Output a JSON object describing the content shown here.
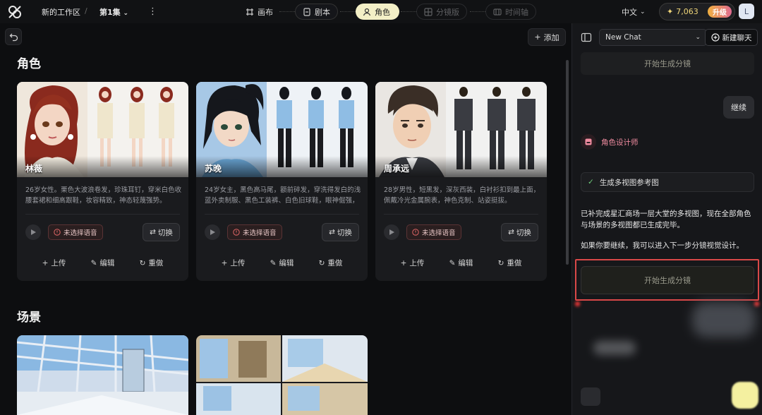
{
  "topbar": {
    "workspace": "新的工作区",
    "separator": "/",
    "episode": "第1集",
    "steps": [
      {
        "label": "画布",
        "icon": "canvas-icon",
        "state": "normal"
      },
      {
        "label": "剧本",
        "icon": "script-icon",
        "state": "normal"
      },
      {
        "label": "角色",
        "icon": "character-icon",
        "state": "active"
      },
      {
        "label": "分镜版",
        "icon": "storyboard-icon",
        "state": "disabled"
      },
      {
        "label": "时间轴",
        "icon": "timeline-icon",
        "state": "disabled"
      }
    ],
    "language": "中文",
    "credits": "7,063",
    "upgrade": "升级",
    "avatar_initial": "L"
  },
  "main": {
    "add_label": "添加",
    "characters_heading": "角色",
    "scenes_heading": "场景",
    "characters": [
      {
        "name": "林薇",
        "desc": "26岁女性。栗色大波浪卷发，珍珠耳钉，穿米白色收腰套裙和细高跟鞋，妆容精致，神态轻蔑强势。",
        "voice": "未选择语音",
        "swap": "切换",
        "upload": "上传",
        "edit": "编辑",
        "redo": "重做"
      },
      {
        "name": "苏晚",
        "desc": "24岁女主，黑色高马尾，额前碎发，穿洗得发白的浅蓝外卖制服、黑色工装裤、白色旧球鞋，眼神倔强，右手...",
        "voice": "未选择语音",
        "swap": "切换",
        "upload": "上传",
        "edit": "编辑",
        "redo": "重做"
      },
      {
        "name": "周承远",
        "desc": "28岁男性，短黑发，深灰西装，白衬衫扣到最上面，佩戴冷光金属腕表，神色克制、站姿挺拔。",
        "voice": "未选择语音",
        "swap": "切换",
        "upload": "上传",
        "edit": "编辑",
        "redo": "重做"
      }
    ]
  },
  "chat": {
    "session": "New Chat",
    "new_chat": "新建聊天",
    "gen_top": "开始生成分镜",
    "continue": "继续",
    "agent": "角色设计师",
    "task": "生成多视图参考图",
    "msg1": "已补完成星汇商场一层大堂的多视图，现在全部角色与场景的多视图都已生成完毕。",
    "msg2": "如果你要继续，我可以进入下一步分镜视觉设计。",
    "gen_bottom": "开始生成分镜"
  },
  "colors": {
    "active_step": "#f3efc6",
    "accent_red": "#d94848",
    "agent_pink": "#f08ca0"
  }
}
